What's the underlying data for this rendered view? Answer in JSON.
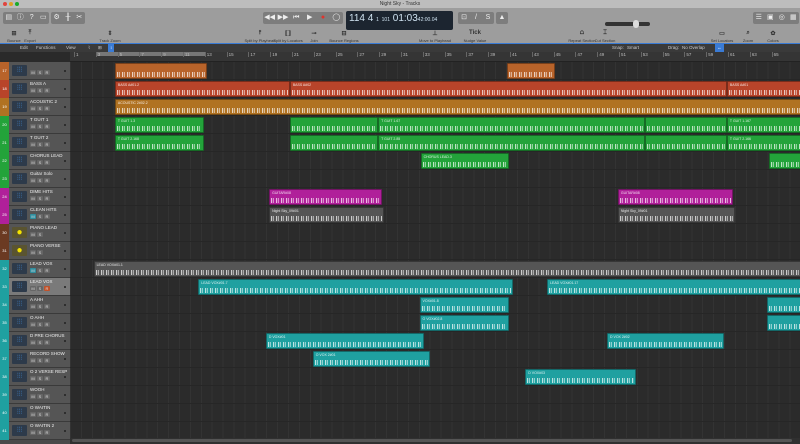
{
  "window": {
    "title": "Night Sky - Tracks"
  },
  "transport": {
    "tempo": "114",
    "bar": "4",
    "beat": "1",
    "div": "1",
    "tick": "101",
    "time": "01:03",
    "time_frames": "42:00.04",
    "buttons": [
      "rewind",
      "fast-forward",
      "go-to-start",
      "play",
      "record",
      "cycle"
    ]
  },
  "toolbar": {
    "items": [
      "Bounce",
      "Export",
      "Track Zoom",
      "Split by Playhead",
      "Split by Locators",
      "Join",
      "Bounce Regions",
      "Move to Playhead",
      "Nudge Value",
      "Repeat Section",
      "Cut Section",
      "Set Locators",
      "Zoom",
      "Colors"
    ],
    "nudge_value": "Tick"
  },
  "editbar": {
    "edit": "Edit",
    "functions": "Functions",
    "view": "View",
    "snap_label": "Snap:",
    "snap_value": "Smart",
    "drag_label": "Drag:",
    "drag_value": "No Overlap"
  },
  "ruler": {
    "bars": [
      "1",
      "3",
      "5",
      "7",
      "9",
      "11",
      "13",
      "15",
      "17",
      "19",
      "21",
      "23",
      "25",
      "27",
      "29",
      "31",
      "33",
      "35",
      "37",
      "39",
      "41",
      "43",
      "45",
      "47",
      "49",
      "51",
      "53",
      "55",
      "57",
      "59",
      "61",
      "63",
      "65"
    ]
  },
  "colors": {
    "orange": "#b8632a",
    "red": "#b8442a",
    "amber": "#b07222",
    "green": "#23a33a",
    "magenta": "#b0209a",
    "gray": "#555555",
    "teal": "#1fa0a0"
  },
  "tracks": [
    {
      "num": "17",
      "name": "",
      "color": "#b8632a",
      "regions": [
        {
          "start": 4.75,
          "end": 13.2,
          "label": "",
          "color": "#b8632a"
        },
        {
          "start": 40.7,
          "end": 45.1,
          "label": "",
          "color": "#b8632a"
        }
      ]
    },
    {
      "num": "18",
      "name": "BASS A",
      "color": "#b8442a",
      "regions": [
        {
          "start": 4.75,
          "end": 20.8,
          "label": "BASS A#01.2",
          "color": "#b8442a"
        },
        {
          "start": 20.8,
          "end": 60.9,
          "label": "BASS A#02",
          "color": "#b8442a"
        },
        {
          "start": 60.9,
          "end": 68,
          "label": "BASS A#01",
          "color": "#b8442a"
        }
      ]
    },
    {
      "num": "19",
      "name": "ACOUSTIC 2",
      "color": "#b07222",
      "regions": [
        {
          "start": 4.75,
          "end": 68,
          "label": "ACOUSTIC 2#02.2",
          "color": "#b07222"
        }
      ]
    },
    {
      "num": "20",
      "name": "T GUIT 1",
      "color": "#23a33a",
      "regions": [
        {
          "start": 4.75,
          "end": 12.9,
          "label": "T GUIT 1.3",
          "color": "#23a33a"
        },
        {
          "start": 20.8,
          "end": 28.9,
          "label": "",
          "color": "#23a33a"
        },
        {
          "start": 28.9,
          "end": 53.4,
          "label": "T GUIT 1.67",
          "color": "#23a33a"
        },
        {
          "start": 53.4,
          "end": 60.9,
          "label": "",
          "color": "#23a33a"
        },
        {
          "start": 60.9,
          "end": 68,
          "label": "T GUIT 1.167",
          "color": "#23a33a"
        }
      ]
    },
    {
      "num": "21",
      "name": "T GUIT 2",
      "color": "#23a33a",
      "regions": [
        {
          "start": 4.75,
          "end": 12.9,
          "label": "T GUIT 2.168",
          "color": "#23a33a"
        },
        {
          "start": 20.8,
          "end": 28.9,
          "label": "",
          "color": "#23a33a"
        },
        {
          "start": 28.9,
          "end": 53.4,
          "label": "T GUIT 2.85",
          "color": "#23a33a"
        },
        {
          "start": 53.4,
          "end": 60.9,
          "label": "",
          "color": "#23a33a"
        },
        {
          "start": 60.9,
          "end": 68,
          "label": "T GUIT 2.166",
          "color": "#23a33a"
        }
      ]
    },
    {
      "num": "22",
      "name": "CHORUS LEAD",
      "color": "#23a33a",
      "regions": [
        {
          "start": 32.8,
          "end": 40.9,
          "label": "CHORUS LEAD.3",
          "color": "#23a33a"
        },
        {
          "start": 64.8,
          "end": 68,
          "label": "",
          "color": "#23a33a"
        }
      ]
    },
    {
      "num": "23",
      "name": "Guitar Solo",
      "color": "#23a33a",
      "regions": []
    },
    {
      "num": "24",
      "name": "DIME HITS",
      "color": "#b0209a",
      "regions": [
        {
          "start": 18.9,
          "end": 29.3,
          "label": "GUITAR#08",
          "color": "#b0209a"
        },
        {
          "start": 50.9,
          "end": 61.5,
          "label": "GUITAR#08",
          "color": "#b0209a"
        }
      ]
    },
    {
      "num": "25",
      "name": "CLEAN HITS",
      "color": "#b0209a",
      "m_on": true,
      "regions": [
        {
          "start": 18.9,
          "end": 29.4,
          "label": "Night Sky_09#01",
          "color": "#555555"
        },
        {
          "start": 50.9,
          "end": 61.6,
          "label": "Night Sky_09#01",
          "color": "#555555"
        }
      ]
    },
    {
      "num": "30",
      "name": "PIANO LEAD",
      "color": "#6b3a22",
      "instrument": true,
      "regions": []
    },
    {
      "num": "31",
      "name": "PIANO VERSE",
      "color": "#6b3a22",
      "instrument": true,
      "regions": []
    },
    {
      "num": "32",
      "name": "LEAD VOX",
      "color": "#1fa0a0",
      "m_on": true,
      "regions": [
        {
          "start": 2.8,
          "end": 68,
          "label": "LEAD VOX#01.1",
          "color": "#555555"
        }
      ]
    },
    {
      "num": "33",
      "name": "LEAD VOX",
      "color": "#1fa0a0",
      "selected": true,
      "rec_on": true,
      "regions": [
        {
          "start": 12.4,
          "end": 41.3,
          "label": "LEAD VOX#01.7",
          "color": "#1fa0a0"
        },
        {
          "start": 44.4,
          "end": 68,
          "label": "LEAD VOX#01.17",
          "color": "#1fa0a0"
        }
      ]
    },
    {
      "num": "34",
      "name": "A AHH",
      "color": "#1fa0a0",
      "regions": [
        {
          "start": 32.7,
          "end": 40.9,
          "label": "VOX#01.8",
          "color": "#1fa0a0"
        },
        {
          "start": 64.6,
          "end": 68,
          "label": "",
          "color": "#1fa0a0"
        }
      ]
    },
    {
      "num": "35",
      "name": "O AHH",
      "color": "#1fa0a0",
      "regions": [
        {
          "start": 32.7,
          "end": 40.9,
          "label": "O VOX#02.8",
          "color": "#1fa0a0"
        },
        {
          "start": 64.6,
          "end": 68,
          "label": "",
          "color": "#1fa0a0"
        }
      ]
    },
    {
      "num": "36",
      "name": "D PRE CHORUS",
      "color": "#1fa0a0",
      "regions": [
        {
          "start": 18.6,
          "end": 33.1,
          "label": "D VOX#01",
          "color": "#1fa0a0"
        },
        {
          "start": 49.9,
          "end": 60.6,
          "label": "D VOX 2#02",
          "color": "#1fa0a0"
        }
      ]
    },
    {
      "num": "37",
      "name": "RECORD SHOW",
      "color": "#1fa0a0",
      "regions": [
        {
          "start": 22.9,
          "end": 33.7,
          "label": "O VOX 2#01",
          "color": "#1fa0a0"
        }
      ]
    },
    {
      "num": "38",
      "name": "O 2 VERSE RESP",
      "color": "#1fa0a0",
      "regions": [
        {
          "start": 42.4,
          "end": 52.6,
          "label": "D VOX#03",
          "color": "#1fa0a0"
        }
      ]
    },
    {
      "num": "39",
      "name": "WOOH",
      "color": "#1fa0a0",
      "regions": []
    },
    {
      "num": "40",
      "name": "O WAITIN",
      "color": "#1fa0a0",
      "regions": []
    },
    {
      "num": "41",
      "name": "O WAITIN 2",
      "color": "#1fa0a0",
      "regions": []
    }
  ],
  "labels": {
    "m": "M",
    "s": "S",
    "r": "R"
  }
}
